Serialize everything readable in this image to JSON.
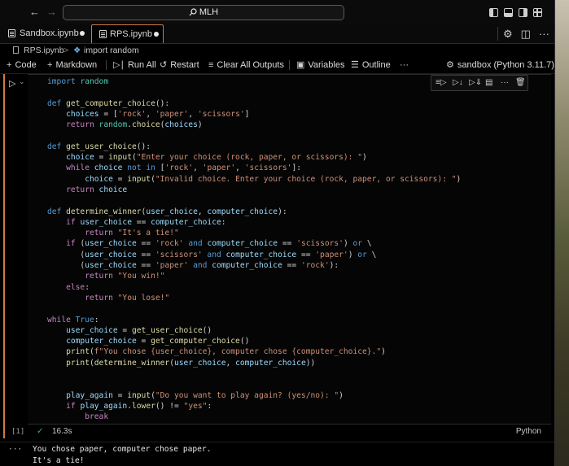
{
  "window": {
    "command_center": "MLH"
  },
  "tabs": [
    {
      "label": "Sandbox.ipynb",
      "dirty": true,
      "active": false
    },
    {
      "label": "RPS.ipynb",
      "dirty": true,
      "active": true
    }
  ],
  "breadcrumb": {
    "file": "RPS.ipynb",
    "separator": ">",
    "cell": "import random"
  },
  "toolbar": {
    "code": "Code",
    "markdown": "Markdown",
    "run_all": "Run All",
    "restart": "Restart",
    "clear_all_outputs": "Clear All Outputs",
    "variables": "Variables",
    "outline": "Outline",
    "more": "···",
    "kernel": "sandbox (Python 3.11.7)"
  },
  "cell": {
    "execution_count": "[1]",
    "duration": "16.3s",
    "language": "Python",
    "code_lines": [
      "import random",
      "",
      "def get_computer_choice():",
      "    choices = ['rock', 'paper', 'scissors']",
      "    return random.choice(choices)",
      "",
      "def get_user_choice():",
      "    choice = input(\"Enter your choice (rock, paper, or scissors): \")",
      "    while choice not in ['rock', 'paper', 'scissors']:",
      "        choice = input(\"Invalid choice. Enter your choice (rock, paper, or scissors): \")",
      "    return choice",
      "",
      "def determine_winner(user_choice, computer_choice):",
      "    if user_choice == computer_choice:",
      "        return \"It's a tie!\"",
      "    if (user_choice == 'rock' and computer_choice == 'scissors') or \\",
      "       (user_choice == 'scissors' and computer_choice == 'paper') or \\",
      "       (user_choice == 'paper' and computer_choice == 'rock'):",
      "        return \"You win!\"",
      "    else:",
      "        return \"You lose!\"",
      "",
      "while True:",
      "    user_choice = get_user_choice()",
      "    computer_choice = get_computer_choice()",
      "    print(f\"You chose {user_choice}, computer chose {computer_choice}.\")",
      "    print(determine_winner(user_choice, computer_choice))",
      "",
      "",
      "    play_again = input(\"Do you want to play again? (yes/no): \")",
      "    if play_again.lower() != \"yes\":",
      "        break"
    ]
  },
  "output": {
    "more": "···",
    "lines": [
      "You chose paper, computer chose paper.",
      "It's a tie!"
    ]
  },
  "colors": {
    "accent": "#d17a3f",
    "keyword": "#569cd6",
    "control": "#c586c0",
    "function": "#dcdcaa",
    "string": "#ce9178",
    "variable": "#9cdcfe",
    "success": "#4fb060"
  },
  "icons": {
    "run_cell": "play-icon",
    "cell_toolbar": [
      "execute-above-icon",
      "execute-below-icon",
      "execute-and-below-icon",
      "split-cell-icon",
      "more-icon",
      "trash-icon"
    ]
  }
}
